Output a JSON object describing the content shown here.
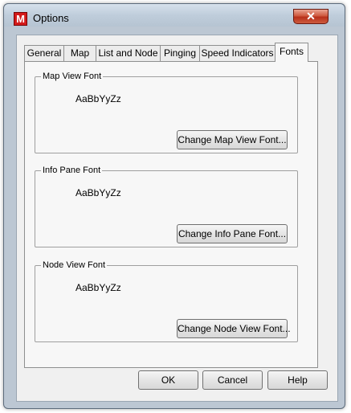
{
  "window": {
    "title": "Options",
    "app_icon_letter": "M",
    "close_glyph": "✕"
  },
  "tabs": [
    {
      "label": "General"
    },
    {
      "label": "Map"
    },
    {
      "label": "List and Node"
    },
    {
      "label": "Pinging"
    },
    {
      "label": "Speed Indicators"
    },
    {
      "label": "Fonts",
      "active": true
    }
  ],
  "fonts_page": {
    "map_view": {
      "legend": "Map View Font",
      "sample": "AaBbYyZz",
      "button": "Change Map View Font..."
    },
    "info_pane": {
      "legend": "Info Pane Font",
      "sample": "AaBbYyZz",
      "button": "Change Info Pane Font..."
    },
    "node_view": {
      "legend": "Node View Font",
      "sample": "AaBbYyZz",
      "button": "Change Node View Font..."
    }
  },
  "footer": {
    "ok_label": "OK",
    "cancel_label": "Cancel",
    "help_label": "Help"
  },
  "colors": {
    "app_icon_red": "#d31a1a",
    "close_button_red": "#c0392b"
  }
}
